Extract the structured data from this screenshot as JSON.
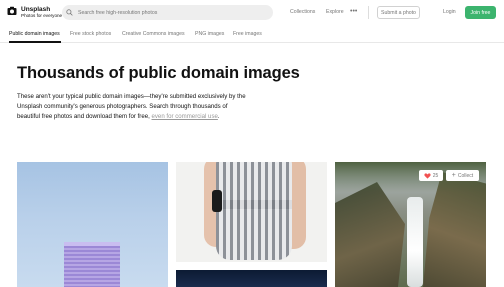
{
  "header": {
    "brand_name": "Unsplash",
    "brand_tagline": "Photos for everyone",
    "search_placeholder": "Search free high-resolution photos",
    "nav": [
      "Collections",
      "Explore"
    ],
    "submit_label": "Submit a photo",
    "login_label": "Login",
    "join_label": "Join free"
  },
  "tabs": [
    {
      "label": "Public domain images",
      "active": true
    },
    {
      "label": "Free stock photos",
      "active": false
    },
    {
      "label": "Creative Commons images",
      "active": false
    },
    {
      "label": "PNG images",
      "active": false
    },
    {
      "label": "Free images",
      "active": false
    }
  ],
  "hero": {
    "title": "Thousands of public domain images",
    "description": "These aren't your typical public domain images—they're submitted exclusively by the Unsplash community's generous photographers. Search through thousands of beautiful free photos and download them for free,",
    "link_text": "even for commercial use",
    "period": "."
  },
  "photo_actions": {
    "like_count": "25",
    "collect_label": "Collect"
  },
  "colors": {
    "accent": "#3cb46e",
    "heart": "#f15151"
  }
}
